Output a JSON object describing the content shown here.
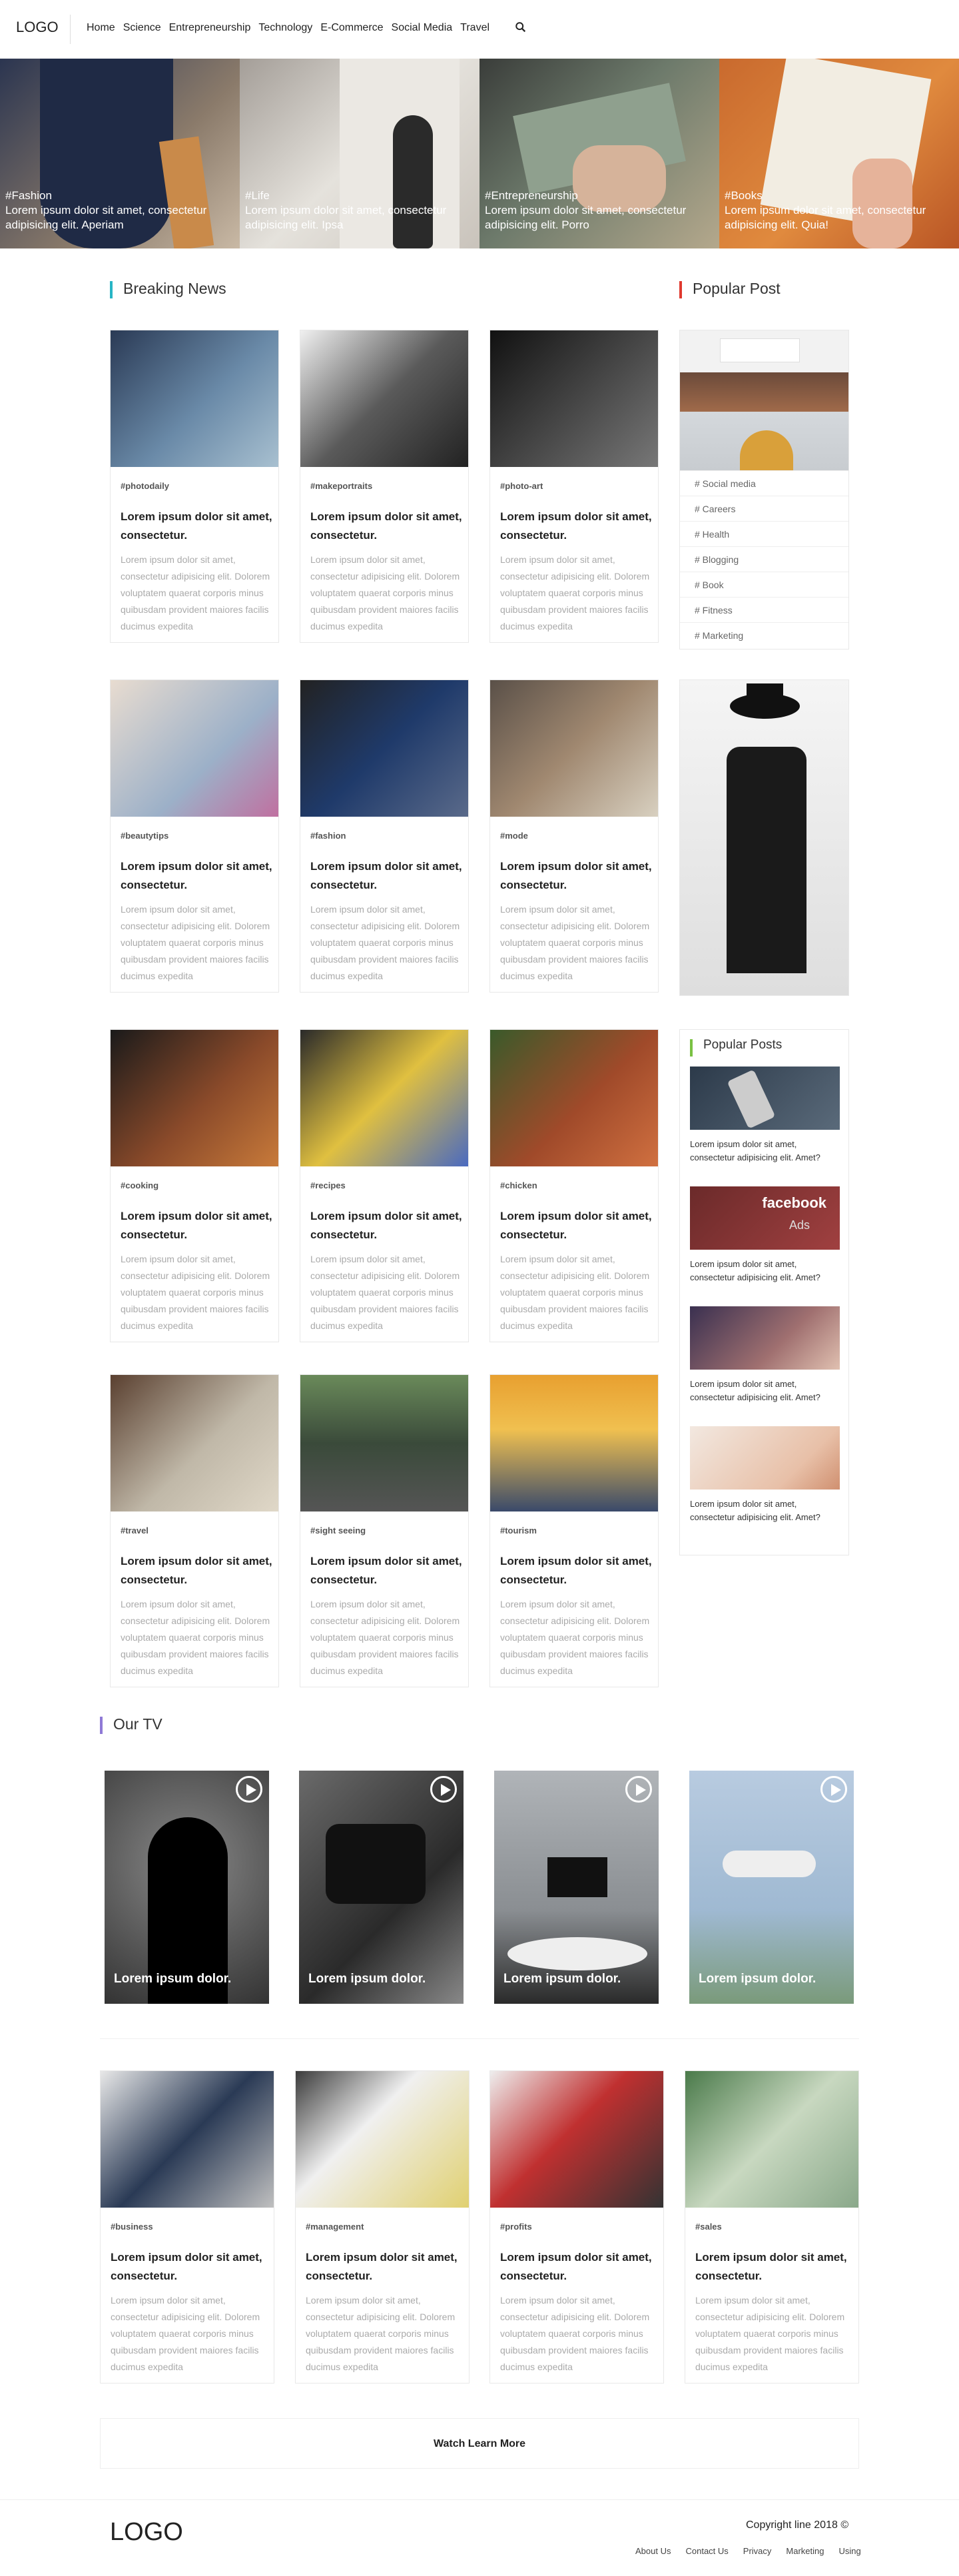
{
  "header": {
    "logo": "LOGO",
    "nav": [
      "Home",
      "Science",
      "Entrepreneurship",
      "Technology",
      "E-Commerce",
      "Social Media",
      "Travel"
    ],
    "search_icon": "search-icon"
  },
  "hero": [
    {
      "tag": "#Fashion",
      "caption": "Lorem ipsum dolor sit amet, consectetur adipisicing elit. Aperiam"
    },
    {
      "tag": "#Life",
      "caption": "Lorem ipsum dolor sit amet, consectetur adipisicing elit. Ipsa"
    },
    {
      "tag": "#Entrepreneurship",
      "caption": "Lorem ipsum dolor sit amet, consectetur adipisicing elit. Porro"
    },
    {
      "tag": "#Books",
      "caption": "Lorem ipsum dolor sit amet, consectetur adipisicing elit. Quia!"
    }
  ],
  "breaking": {
    "title": "Breaking News",
    "color": "#27b5c5"
  },
  "popular": {
    "title": "Popular Post",
    "color": "#e03a2f",
    "tags": [
      "# Social media",
      "# Careers",
      "# Health",
      "# Blogging",
      "# Book",
      "# Fitness",
      "# Marketing"
    ]
  },
  "card_title": "Lorem ipsum dolor sit amet, consectetur.",
  "card_text": "Lorem ipsum dolor sit amet, consectetur adipisicing elit. Dolorem voluptatem quaerat corporis minus quibusdam provident maiores facilis ducimus expedita",
  "cards": [
    "#photodaily",
    "#makeportraits",
    "#photo-art",
    "#beautytips",
    "#fashion",
    "#mode",
    "#cooking",
    "#recipes",
    "#chicken",
    "#travel",
    "#sight seeing",
    "#tourism"
  ],
  "popular_posts": {
    "title": "Popular Posts",
    "color": "#7ac143",
    "item_text": "Lorem ipsum dolor sit amet, consectetur adipisicing elit. Amet?",
    "facebook": "facebook",
    "ads": "Ads"
  },
  "tv": {
    "title": "Our TV",
    "color": "#8f7ad6",
    "label": "Lorem ipsum dolor."
  },
  "bottom_cards": [
    "#business",
    "#management",
    "#profits",
    "#sales"
  ],
  "watch": "Watch Learn More",
  "footer": {
    "logo": "LOGO",
    "copy": "Copyright line 2018 ©",
    "links": [
      "About Us",
      "Contact Us",
      "Privacy",
      "Marketing",
      "Using"
    ]
  }
}
